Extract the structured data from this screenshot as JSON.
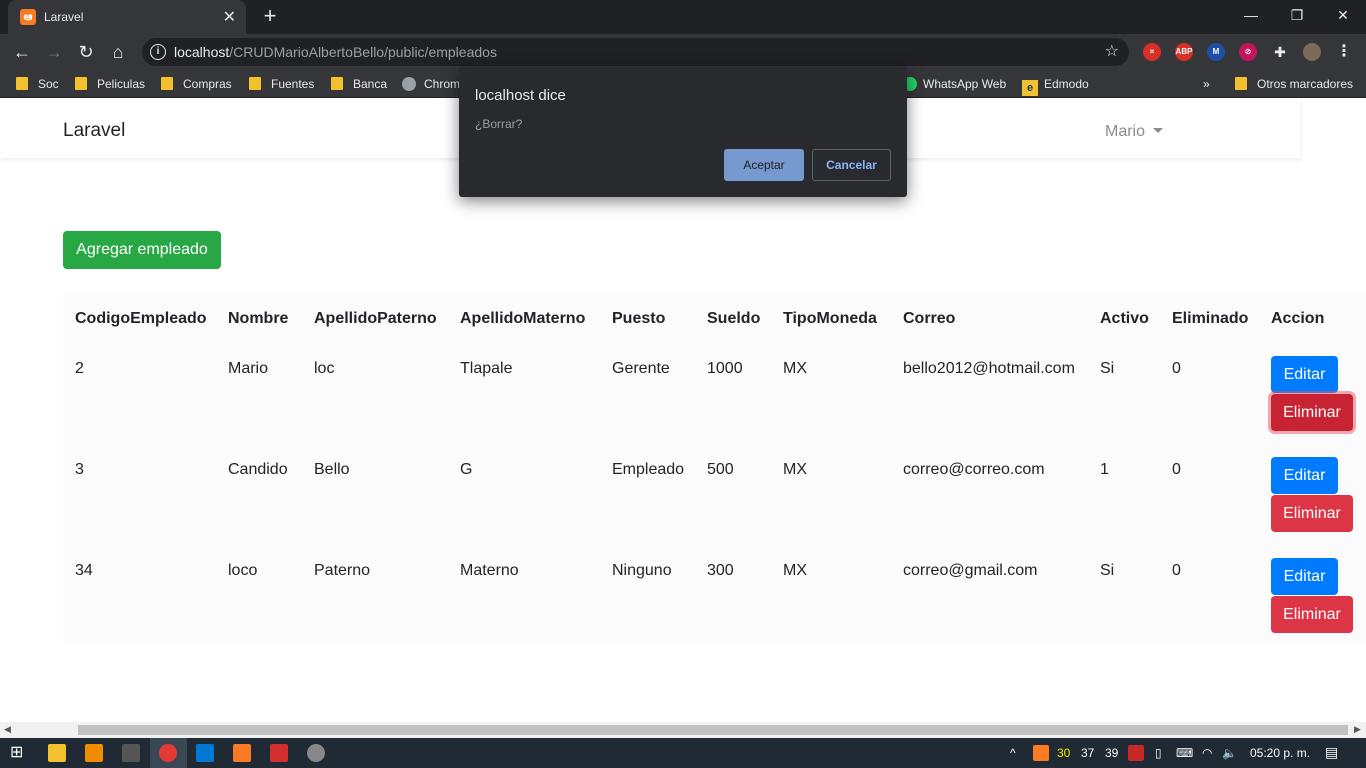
{
  "browser": {
    "tab_title": "Laravel",
    "tab_icon": "xampp-icon",
    "url_host": "localhost",
    "url_path": "/CRUDMarioAlbertoBello/public/empleados",
    "bookmarks": [
      "Soc",
      "Peliculas",
      "Compras",
      "Fuentes",
      "Banca",
      "Chrom",
      "WhatsApp Web",
      "Edmodo",
      "»",
      "Otros marcadores"
    ],
    "extensions": [
      "ABP"
    ]
  },
  "app": {
    "brand": "Laravel",
    "user": "Mario",
    "add_button": "Agregar empleado"
  },
  "table": {
    "headers": [
      "CodigoEmpleado",
      "Nombre",
      "ApellidoPaterno",
      "ApellidoMaterno",
      "Puesto",
      "Sueldo",
      "TipoMoneda",
      "Correo",
      "Activo",
      "Eliminado",
      "Accion"
    ],
    "rows": [
      [
        "2",
        "Mario",
        "loc",
        "Tlapale",
        "Gerente",
        "1000",
        "MX",
        "bello2012@hotmail.com",
        "Si",
        "0"
      ],
      [
        "3",
        "Candido",
        "Bello",
        "G",
        "Empleado",
        "500",
        "MX",
        "correo@correo.com",
        "1",
        "0"
      ],
      [
        "34",
        "loco",
        "Paterno",
        "Materno",
        "Ninguno",
        "300",
        "MX",
        "correo@gmail.com",
        "Si",
        "0"
      ]
    ],
    "edit_label": "Editar",
    "delete_label": "Eliminar"
  },
  "dialog": {
    "title": "localhost dice",
    "message": "¿Borrar?",
    "ok": "Aceptar",
    "cancel": "Cancelar"
  },
  "taskbar": {
    "tray_numbers": [
      "30",
      "37",
      "39"
    ],
    "time": "05:20 p. m."
  },
  "colors": {
    "success": "#28a745",
    "primary": "#007bff",
    "danger": "#dc3545",
    "chrome_dark": "#202124"
  }
}
